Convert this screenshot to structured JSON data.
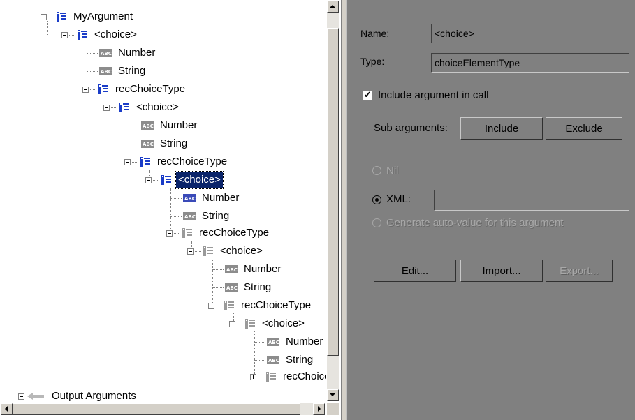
{
  "tree": {
    "nodes": [
      {
        "label": "MyArgument",
        "icon": "struct-icon"
      },
      {
        "label": "<choice>",
        "icon": "struct-icon"
      },
      {
        "label": "Number",
        "icon": "abc-icon"
      },
      {
        "label": "String",
        "icon": "abc-icon"
      },
      {
        "label": "recChoiceType",
        "icon": "struct-icon"
      },
      {
        "label": "<choice>",
        "icon": "struct-icon"
      },
      {
        "label": "Number",
        "icon": "abc-icon"
      },
      {
        "label": "String",
        "icon": "abc-icon"
      },
      {
        "label": "recChoiceType",
        "icon": "struct-icon"
      },
      {
        "label": "<choice>",
        "icon": "struct-icon",
        "selected": true
      },
      {
        "label": "Number",
        "icon": "abc-icon"
      },
      {
        "label": "String",
        "icon": "abc-icon"
      },
      {
        "label": "recChoiceType",
        "icon": "struct-icon"
      },
      {
        "label": "<choice>",
        "icon": "struct-icon"
      },
      {
        "label": "Number",
        "icon": "abc-icon"
      },
      {
        "label": "String",
        "icon": "abc-icon"
      },
      {
        "label": "recChoiceType",
        "icon": "struct-icon"
      },
      {
        "label": "<choice>",
        "icon": "struct-icon"
      },
      {
        "label": "Number",
        "icon": "abc-icon"
      },
      {
        "label": "String",
        "icon": "abc-icon"
      },
      {
        "label": "recChoiceType",
        "icon": "struct-icon"
      },
      {
        "label": "Output Arguments",
        "icon": "arrow-left-icon"
      }
    ]
  },
  "details": {
    "name_label": "Name:",
    "name_value": "<choice>",
    "type_label": "Type:",
    "type_value": "choiceElementType",
    "include_checkbox_label": "Include argument in call",
    "include_checked": true,
    "sub_arguments_label": "Sub arguments:",
    "include_button": "Include",
    "exclude_button": "Exclude",
    "nil_label": "Nil",
    "xml_label": "XML:",
    "xml_value": "",
    "generate_label": "Generate auto-value for this argument",
    "edit_button": "Edit...",
    "import_button": "Import...",
    "export_button": "Export..."
  },
  "colors": {
    "selection": "#0a246a",
    "panel_gray": "#808080",
    "struct_blue": "#1a3cc8",
    "abc_gray": "#8c8c8c"
  }
}
